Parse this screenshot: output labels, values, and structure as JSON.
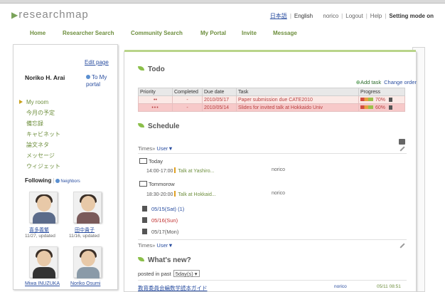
{
  "header": {
    "logo": "researchmap",
    "links": {
      "japanese": "日本語",
      "english": "English",
      "user": "norico",
      "logout": "Logout",
      "help": "Help",
      "setting": "Setting mode on"
    }
  },
  "nav": {
    "items": [
      "Home",
      "Researcher Search",
      "Community Search",
      "My Portal",
      "Invite",
      "Message"
    ]
  },
  "sidebar": {
    "edit_page": "Edit page",
    "user_name": "Noriko H. Arai",
    "to_my_portal": "To My portal",
    "menu": [
      "My room",
      "今月の予定",
      "備忘録",
      "キャビネット",
      "論文ネタ",
      "メッセージ",
      "ウィジェット"
    ],
    "following_label": "Following",
    "neighbors_label": "Neighbors",
    "people": [
      {
        "name": "喜多義繁",
        "updated": "11/27, updated"
      },
      {
        "name": "田中貴子",
        "updated": "11/16, updated"
      },
      {
        "name": "Miwa INUZUKA",
        "updated": ""
      },
      {
        "name": "Noriko Osumi",
        "updated": ""
      }
    ]
  },
  "todo": {
    "title": "Todo",
    "add_task": "Add task",
    "change_order": "Change order",
    "columns": [
      "Priority",
      "Completed",
      "Due date",
      "Task",
      "Progress"
    ],
    "rows": [
      {
        "priority": "••",
        "completed": "-",
        "due": "2010/05/17",
        "task": "Paper submission due CATE2010",
        "progress": "70%"
      },
      {
        "priority": "•••",
        "completed": "-",
        "due": "2010/05/14",
        "task": "Slides for invited talk at Hokkaido Univ",
        "progress": "60%"
      }
    ]
  },
  "schedule": {
    "title": "Schedule",
    "times_label": "Times»",
    "user_label": "User▼",
    "today": "Today",
    "today_event": {
      "time": "14:00-17:00",
      "title": "Talk at Yashiro...",
      "owner": "norico"
    },
    "tomorrow": "Tommorow",
    "tomorrow_event": {
      "time": "18:30-20:00",
      "title": "Talk at Hokkaid...",
      "owner": "norico"
    },
    "days": [
      {
        "label": "05/15(Sat) (1)",
        "color": "#2a4ea0"
      },
      {
        "label": "05/16(Sun)",
        "color": "#c03030"
      },
      {
        "label": "05/17(Mon)",
        "color": "#555555"
      }
    ],
    "times_label_bottom": "Times»",
    "user_label_bottom": "User▼"
  },
  "whatsnew": {
    "title": "What's new?",
    "posted_label": "posted in past",
    "period": "5day(s)",
    "items": [
      {
        "title": "教育委員会編数学読本ガイド",
        "owner": "norico",
        "time": "05/11 08:51"
      }
    ]
  }
}
